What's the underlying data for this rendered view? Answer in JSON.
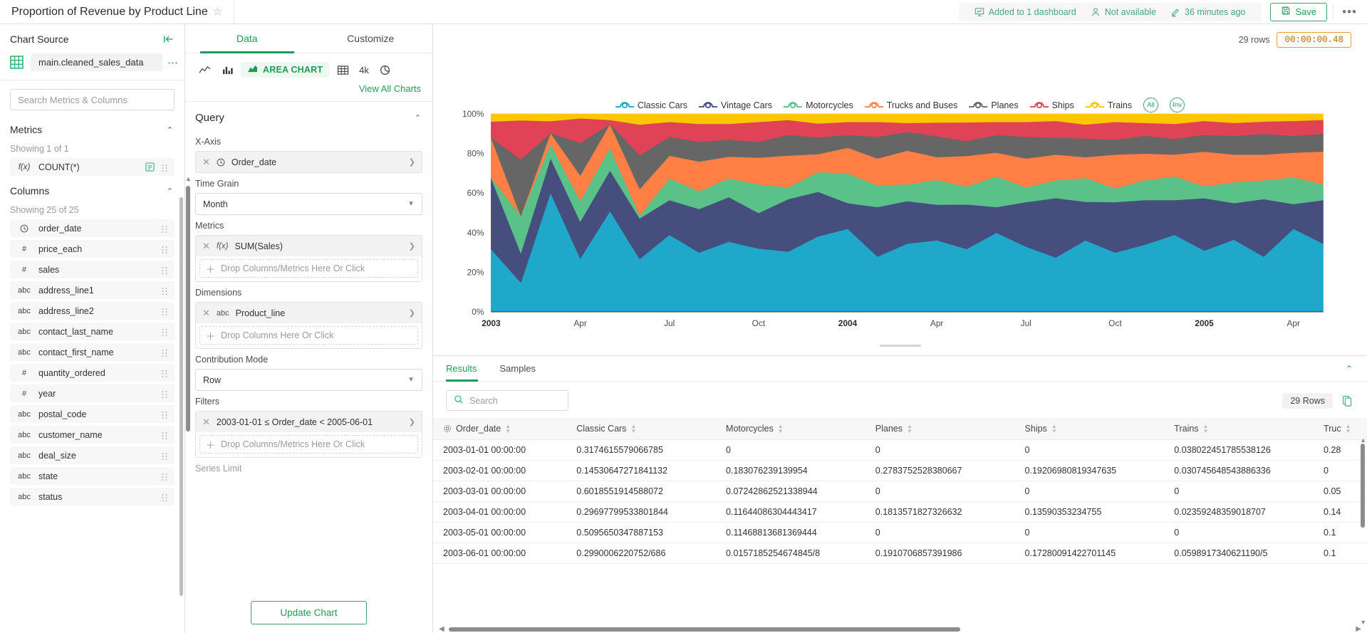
{
  "header": {
    "chart_title": "Proportion of Revenue by Product Line",
    "star_icon": "star-outline-icon",
    "meta": [
      {
        "icon": "dashboard-icon",
        "label": "Added to 1 dashboard"
      },
      {
        "icon": "user-icon",
        "label": "Not available"
      },
      {
        "icon": "pencil-icon",
        "label": "36 minutes ago"
      }
    ],
    "save_label": "Save",
    "more_label": "•••"
  },
  "left_panel": {
    "title": "Chart Source",
    "collapse_icon": "collapse-left-icon",
    "dataset_name": "main.cleaned_sales_data",
    "dataset_menu_icon": "kebab-menu-icon",
    "search_placeholder": "Search Metrics & Columns",
    "metrics_section": {
      "title": "Metrics",
      "showing": "Showing 1 of 1",
      "items": [
        {
          "type": "f(x)",
          "label": "COUNT(*)",
          "badge": "certified-icon"
        }
      ]
    },
    "columns_section": {
      "title": "Columns",
      "showing": "Showing 25 of 25",
      "items": [
        {
          "type": "clock",
          "label": "order_date"
        },
        {
          "type": "#",
          "label": "price_each"
        },
        {
          "type": "#",
          "label": "sales"
        },
        {
          "type": "abc",
          "label": "address_line1"
        },
        {
          "type": "abc",
          "label": "address_line2"
        },
        {
          "type": "abc",
          "label": "contact_last_name"
        },
        {
          "type": "abc",
          "label": "contact_first_name"
        },
        {
          "type": "#",
          "label": "quantity_ordered"
        },
        {
          "type": "#",
          "label": "year"
        },
        {
          "type": "abc",
          "label": "postal_code"
        },
        {
          "type": "abc",
          "label": "customer_name"
        },
        {
          "type": "abc",
          "label": "deal_size"
        },
        {
          "type": "abc",
          "label": "state"
        },
        {
          "type": "abc",
          "label": "status"
        }
      ]
    }
  },
  "control_panel": {
    "tabs": [
      {
        "label": "Data",
        "active": true
      },
      {
        "label": "Customize",
        "active": false
      }
    ],
    "viz_types": [
      {
        "icon": "line-chart-icon",
        "label": ""
      },
      {
        "icon": "bar-chart-icon",
        "label": ""
      },
      {
        "icon": "area-chart-icon",
        "label": "AREA CHART",
        "selected": true
      },
      {
        "icon": "table-icon",
        "label": ""
      },
      {
        "icon": "4k-icon",
        "label": "4k"
      },
      {
        "icon": "pie-chart-icon",
        "label": ""
      }
    ],
    "view_all_charts": "View All Charts",
    "query_title": "Query",
    "x_axis": {
      "label": "X-Axis",
      "pill_type": "clock",
      "pill_text": "Order_date"
    },
    "time_grain": {
      "label": "Time Grain",
      "value": "Month"
    },
    "metrics": {
      "label": "Metrics",
      "pill_type": "f(x)",
      "pill_text": "SUM(Sales)",
      "dropzone": "Drop Columns/Metrics Here Or Click"
    },
    "dimensions": {
      "label": "Dimensions",
      "pill_type": "abc",
      "pill_text": "Product_line",
      "dropzone": "Drop Columns Here Or Click"
    },
    "contribution_mode": {
      "label": "Contribution Mode",
      "value": "Row"
    },
    "filters": {
      "label": "Filters",
      "pill_text": "2003-01-01 ≤ Order_date < 2005-06-01",
      "dropzone": "Drop Columns/Metrics Here Or Click"
    },
    "series_limit_label": "Series Limit",
    "update_chart_label": "Update Chart"
  },
  "chart_area": {
    "rows_badge": "29 rows",
    "time_badge": "00:00:00.48",
    "legend_all": "All",
    "legend_inv": "Inv"
  },
  "results": {
    "tabs": [
      {
        "label": "Results",
        "active": true
      },
      {
        "label": "Samples",
        "active": false
      }
    ],
    "collapse_icon": "chevron-up-icon",
    "search_placeholder": "Search",
    "rows_chip": "29 Rows",
    "copy_icon": "copy-icon",
    "columns": [
      "Order_date",
      "Classic Cars",
      "Motorcycles",
      "Planes",
      "Ships",
      "Trains",
      "Truc"
    ],
    "rows": [
      [
        "2003-01-01 00:00:00",
        "0.3174615579066785",
        "0",
        "0",
        "0",
        "0.038022451785538126",
        "0.28"
      ],
      [
        "2003-02-01 00:00:00",
        "0.14530647271841132",
        "0.183076239139954",
        "0.2783752528380667",
        "0.19206980819347635",
        "0.030745648543886336",
        "0"
      ],
      [
        "2003-03-01 00:00:00",
        "0.6018551914588072",
        "0.07242862521338944",
        "0",
        "0",
        "0",
        "0.05"
      ],
      [
        "2003-04-01 00:00:00",
        "0.29697799533801844",
        "0.11644086304443417",
        "0.1813571827326632",
        "0.13590353234755",
        "0.02359248359018707",
        "0.14"
      ],
      [
        "2003-05-01 00:00:00",
        "0.5095650347887153",
        "0.11468813681369444",
        "0",
        "0",
        "0",
        "0.1"
      ],
      [
        "2003-06-01 00:00:00",
        "0.2990006220752/686",
        "0.0157185254674845/8",
        "0.1910706857391986",
        "0.17280091422701145",
        "0.0598917340621190/5",
        "0.1"
      ]
    ]
  },
  "chart_data": {
    "type": "area",
    "title": "Proportion of Revenue by Product Line",
    "xlabel": "",
    "ylabel": "",
    "ylim": [
      0,
      1
    ],
    "stacked": true,
    "normalized": true,
    "grid": false,
    "legend_position": "top",
    "ytick_labels": [
      "0%",
      "20%",
      "40%",
      "60%",
      "80%",
      "100%"
    ],
    "xtick_labels": [
      "2003",
      "Apr",
      "Jul",
      "Oct",
      "2004",
      "Apr",
      "Jul",
      "Oct",
      "2005",
      "Apr"
    ],
    "x": [
      "2003-01",
      "2003-02",
      "2003-03",
      "2003-04",
      "2003-05",
      "2003-06",
      "2003-07",
      "2003-08",
      "2003-09",
      "2003-10",
      "2003-11",
      "2003-12",
      "2004-01",
      "2004-02",
      "2004-03",
      "2004-04",
      "2004-05",
      "2004-06",
      "2004-07",
      "2004-08",
      "2004-09",
      "2004-10",
      "2004-11",
      "2004-12",
      "2005-01",
      "2005-02",
      "2005-03",
      "2005-04",
      "2005-05"
    ],
    "series": [
      {
        "name": "Classic Cars",
        "color": "#1FA8C9",
        "values": [
          0.317,
          0.145,
          0.602,
          0.297,
          0.51,
          0.299,
          0.39,
          0.3,
          0.355,
          0.32,
          0.305,
          0.382,
          0.42,
          0.28,
          0.345,
          0.362,
          0.318,
          0.4,
          0.33,
          0.275,
          0.362,
          0.3,
          0.34,
          0.39,
          0.31,
          0.365,
          0.28,
          0.42,
          0.345
        ]
      },
      {
        "name": "Vintage Cars",
        "color": "#454E7C",
        "values": [
          0.36,
          0.145,
          0.175,
          0.205,
          0.205,
          0.23,
          0.175,
          0.22,
          0.225,
          0.18,
          0.265,
          0.225,
          0.13,
          0.25,
          0.215,
          0.18,
          0.225,
          0.13,
          0.225,
          0.3,
          0.195,
          0.255,
          0.225,
          0.175,
          0.265,
          0.185,
          0.29,
          0.125,
          0.22
        ]
      },
      {
        "name": "Motorcycles",
        "color": "#5AC189",
        "values": [
          0.0,
          0.183,
          0.072,
          0.116,
          0.115,
          0.016,
          0.11,
          0.09,
          0.095,
          0.145,
          0.06,
          0.1,
          0.15,
          0.11,
          0.085,
          0.125,
          0.09,
          0.155,
          0.075,
          0.09,
          0.12,
          0.07,
          0.1,
          0.12,
          0.06,
          0.105,
          0.095,
          0.135,
          0.08
        ]
      },
      {
        "name": "Trucks and Buses",
        "color": "#FF7F44",
        "values": [
          0.203,
          0.0,
          0.055,
          0.14,
          0.12,
          0.15,
          0.115,
          0.15,
          0.11,
          0.135,
          0.16,
          0.09,
          0.13,
          0.135,
          0.17,
          0.115,
          0.155,
          0.12,
          0.145,
          0.13,
          0.105,
          0.17,
          0.135,
          0.11,
          0.175,
          0.14,
          0.13,
          0.125,
          0.165
        ]
      },
      {
        "name": "Planes",
        "color": "#666666",
        "values": [
          0.0,
          0.278,
          0.0,
          0.181,
          0.0,
          0.191,
          0.095,
          0.1,
          0.085,
          0.08,
          0.105,
          0.085,
          0.065,
          0.11,
          0.095,
          0.105,
          0.075,
          0.09,
          0.11,
          0.085,
          0.095,
          0.075,
          0.09,
          0.08,
          0.085,
          0.095,
          0.105,
          0.085,
          0.09
        ]
      },
      {
        "name": "Ships",
        "color": "#E04355",
        "values": [
          0.082,
          0.192,
          0.06,
          0.136,
          0.02,
          0.173,
          0.075,
          0.09,
          0.08,
          0.1,
          0.075,
          0.07,
          0.065,
          0.075,
          0.045,
          0.07,
          0.095,
          0.065,
          0.075,
          0.085,
          0.07,
          0.09,
          0.065,
          0.075,
          0.07,
          0.065,
          0.062,
          0.075,
          0.07
        ]
      },
      {
        "name": "Trains",
        "color": "#FCC700",
        "values": [
          0.038,
          0.031,
          0.036,
          0.024,
          0.03,
          0.06,
          0.04,
          0.05,
          0.05,
          0.04,
          0.03,
          0.048,
          0.04,
          0.04,
          0.045,
          0.043,
          0.042,
          0.04,
          0.04,
          0.035,
          0.053,
          0.04,
          0.045,
          0.05,
          0.035,
          0.045,
          0.038,
          0.035,
          0.03
        ]
      }
    ]
  }
}
